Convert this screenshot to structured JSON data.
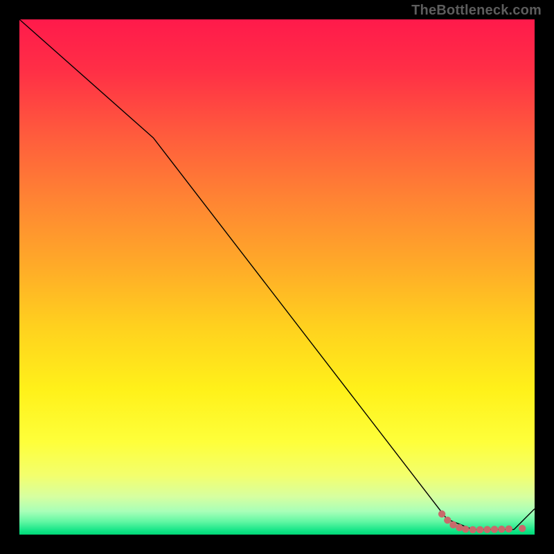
{
  "watermark": "TheBottleneck.com",
  "chart_data": {
    "type": "line",
    "title": "",
    "xlabel": "",
    "ylabel": "",
    "xlim": [
      0,
      100
    ],
    "ylim": [
      0,
      100
    ],
    "grid": false,
    "series": [
      {
        "name": "curve",
        "x": [
          0,
          26,
          83,
          88,
          96,
          100
        ],
        "y": [
          100,
          77,
          3,
          1,
          1,
          5
        ],
        "stroke": "#000000",
        "stroke_width": 1.4
      }
    ],
    "markers": {
      "name": "dotted-floor",
      "color": "#c96a6b",
      "radius": 5.2,
      "spacing": 2.6,
      "points": [
        {
          "x": 82.0,
          "y": 4.0
        },
        {
          "x": 83.1,
          "y": 2.8
        },
        {
          "x": 84.2,
          "y": 1.9
        },
        {
          "x": 85.4,
          "y": 1.35
        },
        {
          "x": 86.6,
          "y": 1.05
        },
        {
          "x": 88.0,
          "y": 0.95
        },
        {
          "x": 89.4,
          "y": 0.95
        },
        {
          "x": 90.8,
          "y": 0.98
        },
        {
          "x": 92.2,
          "y": 1.02
        },
        {
          "x": 93.6,
          "y": 1.05
        },
        {
          "x": 95.0,
          "y": 1.1
        },
        {
          "x": 97.6,
          "y": 1.2
        }
      ]
    },
    "background_gradient": {
      "stops": [
        {
          "offset": 0.0,
          "color": "#ff1a4b"
        },
        {
          "offset": 0.1,
          "color": "#ff2f46"
        },
        {
          "offset": 0.22,
          "color": "#ff5a3d"
        },
        {
          "offset": 0.35,
          "color": "#ff8433"
        },
        {
          "offset": 0.48,
          "color": "#ffab28"
        },
        {
          "offset": 0.6,
          "color": "#ffd21e"
        },
        {
          "offset": 0.72,
          "color": "#fff11a"
        },
        {
          "offset": 0.82,
          "color": "#feff3a"
        },
        {
          "offset": 0.885,
          "color": "#f3ff6d"
        },
        {
          "offset": 0.926,
          "color": "#d7ffa0"
        },
        {
          "offset": 0.955,
          "color": "#a8ffb8"
        },
        {
          "offset": 0.975,
          "color": "#61f7a3"
        },
        {
          "offset": 0.992,
          "color": "#14e587"
        },
        {
          "offset": 1.0,
          "color": "#00d877"
        }
      ]
    }
  }
}
